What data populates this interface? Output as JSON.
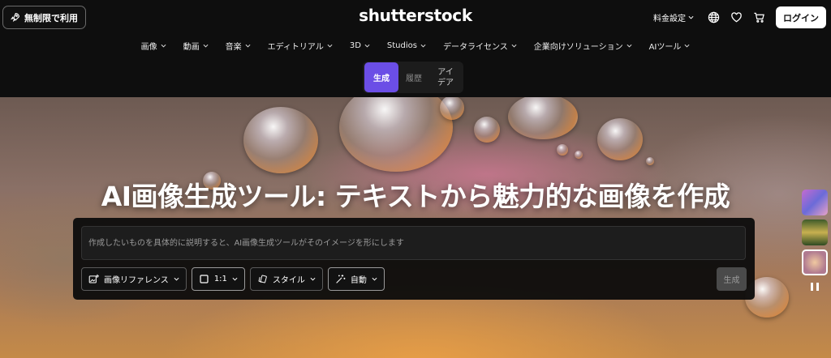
{
  "header": {
    "free_trial_label": "無制限で利用",
    "logo": "shutterstock",
    "pricing_label": "料金設定",
    "login_label": "ログイン"
  },
  "nav": {
    "items": [
      {
        "label": "画像"
      },
      {
        "label": "動画"
      },
      {
        "label": "音楽"
      },
      {
        "label": "エディトリアル"
      },
      {
        "label": "3D"
      },
      {
        "label": "Studios"
      },
      {
        "label": "データライセンス"
      },
      {
        "label": "企業向けソリューション"
      },
      {
        "label": "AIツール"
      }
    ]
  },
  "mode_tabs": {
    "generate": "生成",
    "history": "履歴",
    "ideas_line1": "アイ",
    "ideas_line2": "デア"
  },
  "hero": {
    "title": "AI画像生成ツール: テキストから魅力的な画像を作成",
    "prompt_placeholder": "作成したいものを具体的に説明すると、AI画像生成ツールがそのイメージを形にします",
    "controls": {
      "image_reference": "画像リファレンス",
      "aspect_ratio": "1:1",
      "style": "スタイル",
      "auto": "自動"
    },
    "generate_button": "生成"
  },
  "icons": {
    "rocket": "rocket-icon",
    "globe": "globe-icon",
    "heart": "heart-icon",
    "cart": "cart-icon"
  },
  "colors": {
    "accent": "#6b4ee6",
    "login_bg": "#ffffff"
  }
}
